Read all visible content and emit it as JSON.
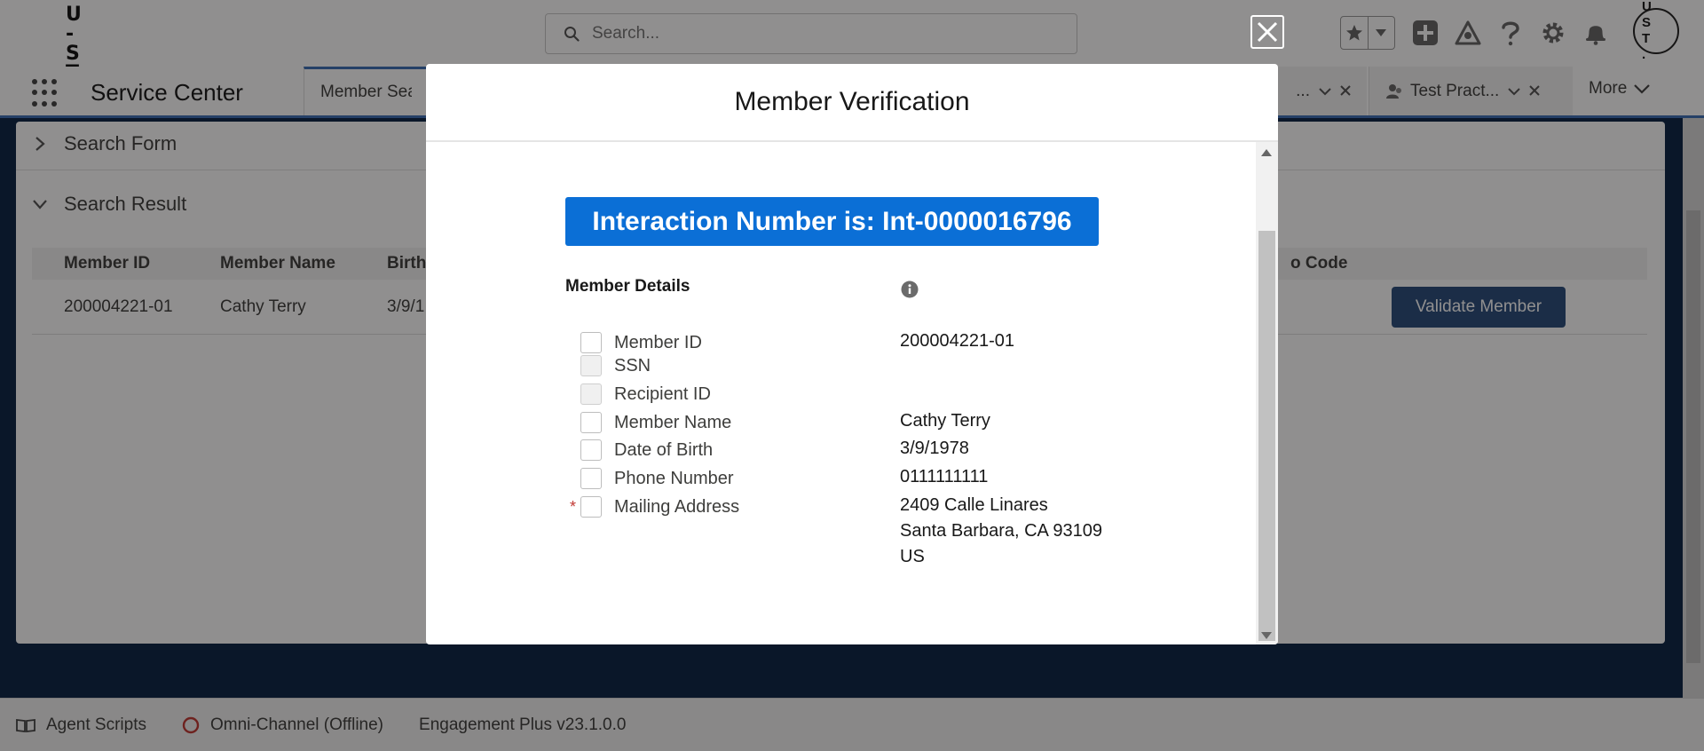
{
  "header": {
    "logo": {
      "line1": "U -",
      "line2": "S T"
    },
    "search": {
      "placeholder": "Search..."
    },
    "avatar": {
      "line1": "U S",
      "line2": "T ."
    }
  },
  "nav": {
    "app_name": "Service Center",
    "tabs": [
      {
        "label": "Member Searc"
      },
      {
        "label": "..."
      },
      {
        "label": "Test Pract..."
      }
    ],
    "more_label": "More"
  },
  "workspace": {
    "search_form_label": "Search Form",
    "search_result_label": "Search Result",
    "table": {
      "columns": [
        "Member ID",
        "Member Name",
        "Birth",
        "o Code"
      ],
      "rows": [
        {
          "member_id": "200004221-01",
          "member_name": "Cathy Terry",
          "birth": "3/9/1"
        }
      ]
    },
    "validate_button": "Validate Member"
  },
  "utility_bar": {
    "items": [
      {
        "label": "Agent Scripts"
      },
      {
        "label": "Omni-Channel (Offline)"
      },
      {
        "label": "Engagement Plus v23.1.0.0"
      }
    ],
    "offline_color": "#c23934"
  },
  "modal": {
    "title": "Member Verification",
    "interaction_banner": "Interaction Number is: Int-0000016796",
    "details_heading": "Member Details",
    "fields": [
      {
        "label": "Member ID",
        "value": "200004221-01",
        "required": false,
        "disabled": false
      },
      {
        "label": "SSN",
        "value": "",
        "required": false,
        "disabled": true
      },
      {
        "label": "Recipient ID",
        "value": "",
        "required": false,
        "disabled": true
      },
      {
        "label": "Member Name",
        "value": "Cathy Terry",
        "required": false,
        "disabled": false
      },
      {
        "label": "Date of Birth",
        "value": "3/9/1978",
        "required": false,
        "disabled": false
      },
      {
        "label": "Phone Number",
        "value": "0111111111",
        "required": false,
        "disabled": false
      },
      {
        "label": "Mailing Address",
        "value": "2409 Calle Linares",
        "required": true,
        "disabled": false
      }
    ],
    "address_lines": [
      "Santa Barbara, CA 93109",
      "US"
    ],
    "required_marker": "*",
    "banner_color": "#0b6fd6",
    "button_color": "#2b4e7d"
  }
}
